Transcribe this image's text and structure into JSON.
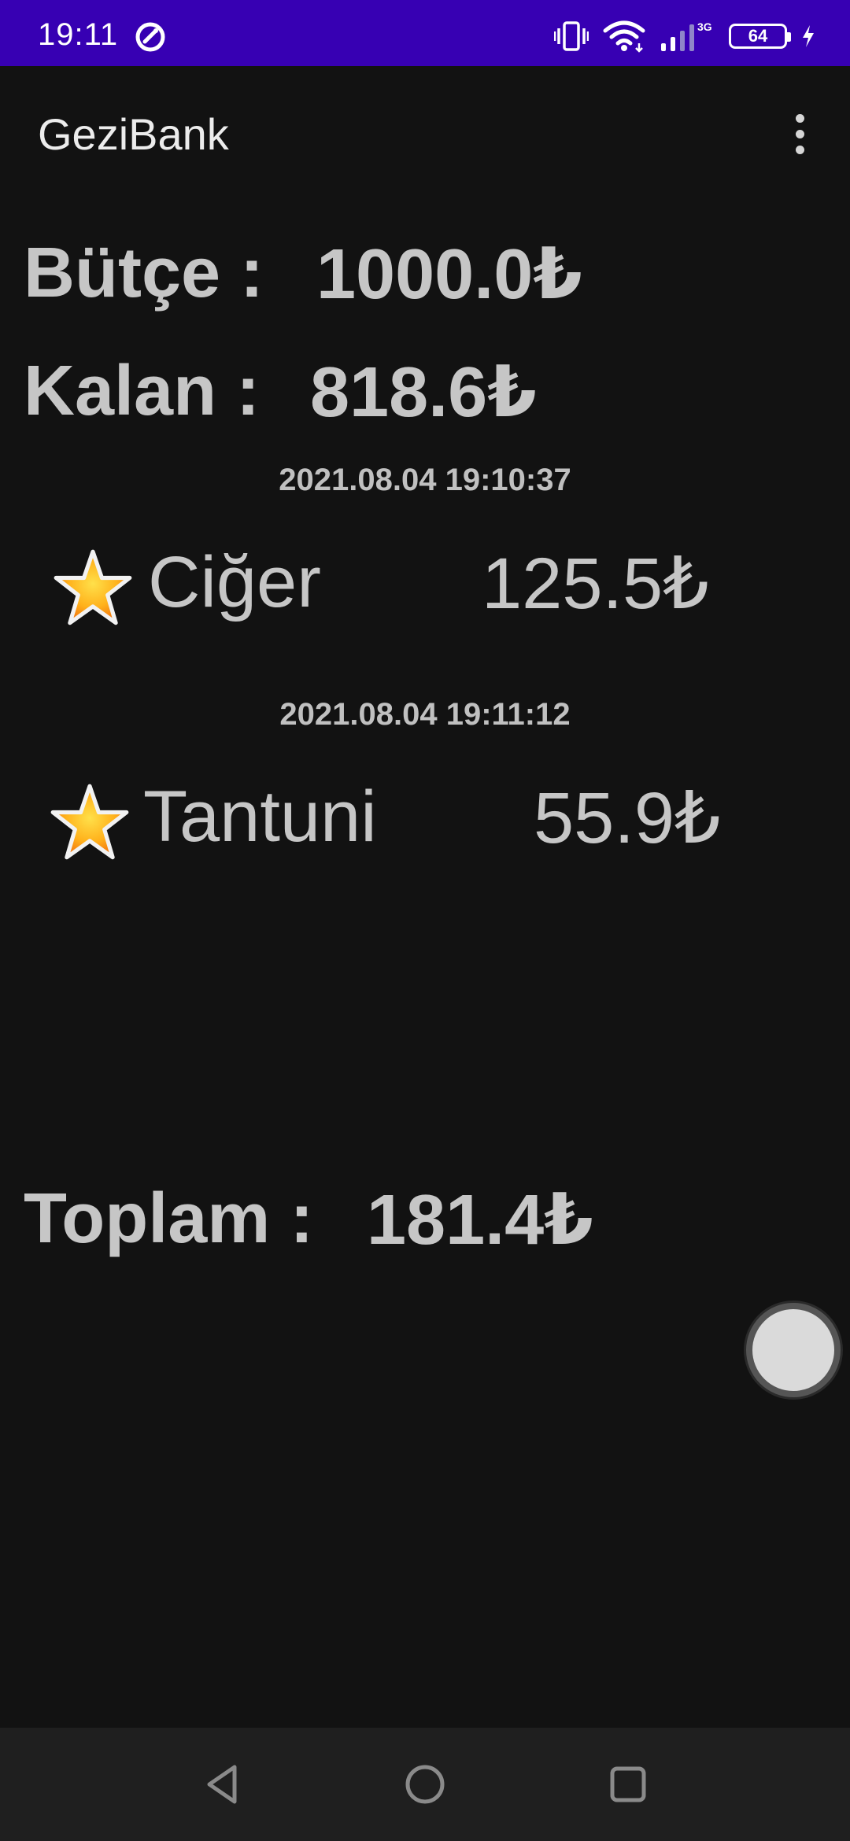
{
  "status_bar": {
    "time": "19:11",
    "network_label": "3G",
    "battery_level": "64"
  },
  "app_bar": {
    "title": "GeziBank"
  },
  "summary": {
    "budget_label": "Bütçe :",
    "budget_value": "1000.0₺",
    "remaining_label": "Kalan :",
    "remaining_value": "818.6₺",
    "total_label": "Toplam :",
    "total_value": "181.4₺"
  },
  "entries": [
    {
      "date": "2021.08.04 19:10:37",
      "name": "Ciğer",
      "amount": "125.5₺"
    },
    {
      "date": "2021.08.04 19:11:12",
      "name": "Tantuni",
      "amount": "55.9₺"
    }
  ],
  "icons": {
    "status_left": "data-saver-icon",
    "vibrate": "vibrate-icon",
    "wifi": "wifi-icon",
    "signal": "signal-icon",
    "battery": "battery-icon",
    "charging": "charging-bolt-icon",
    "overflow": "more-vert-icon",
    "entry_star": "star-icon",
    "nav_back": "back-triangle-icon",
    "nav_home": "home-circle-icon",
    "nav_recents": "recents-square-icon"
  },
  "colors": {
    "status_bar": "#3700b3",
    "background": "#121212",
    "text": "#c6c6c6",
    "nav_bar": "#1f1f1f"
  }
}
